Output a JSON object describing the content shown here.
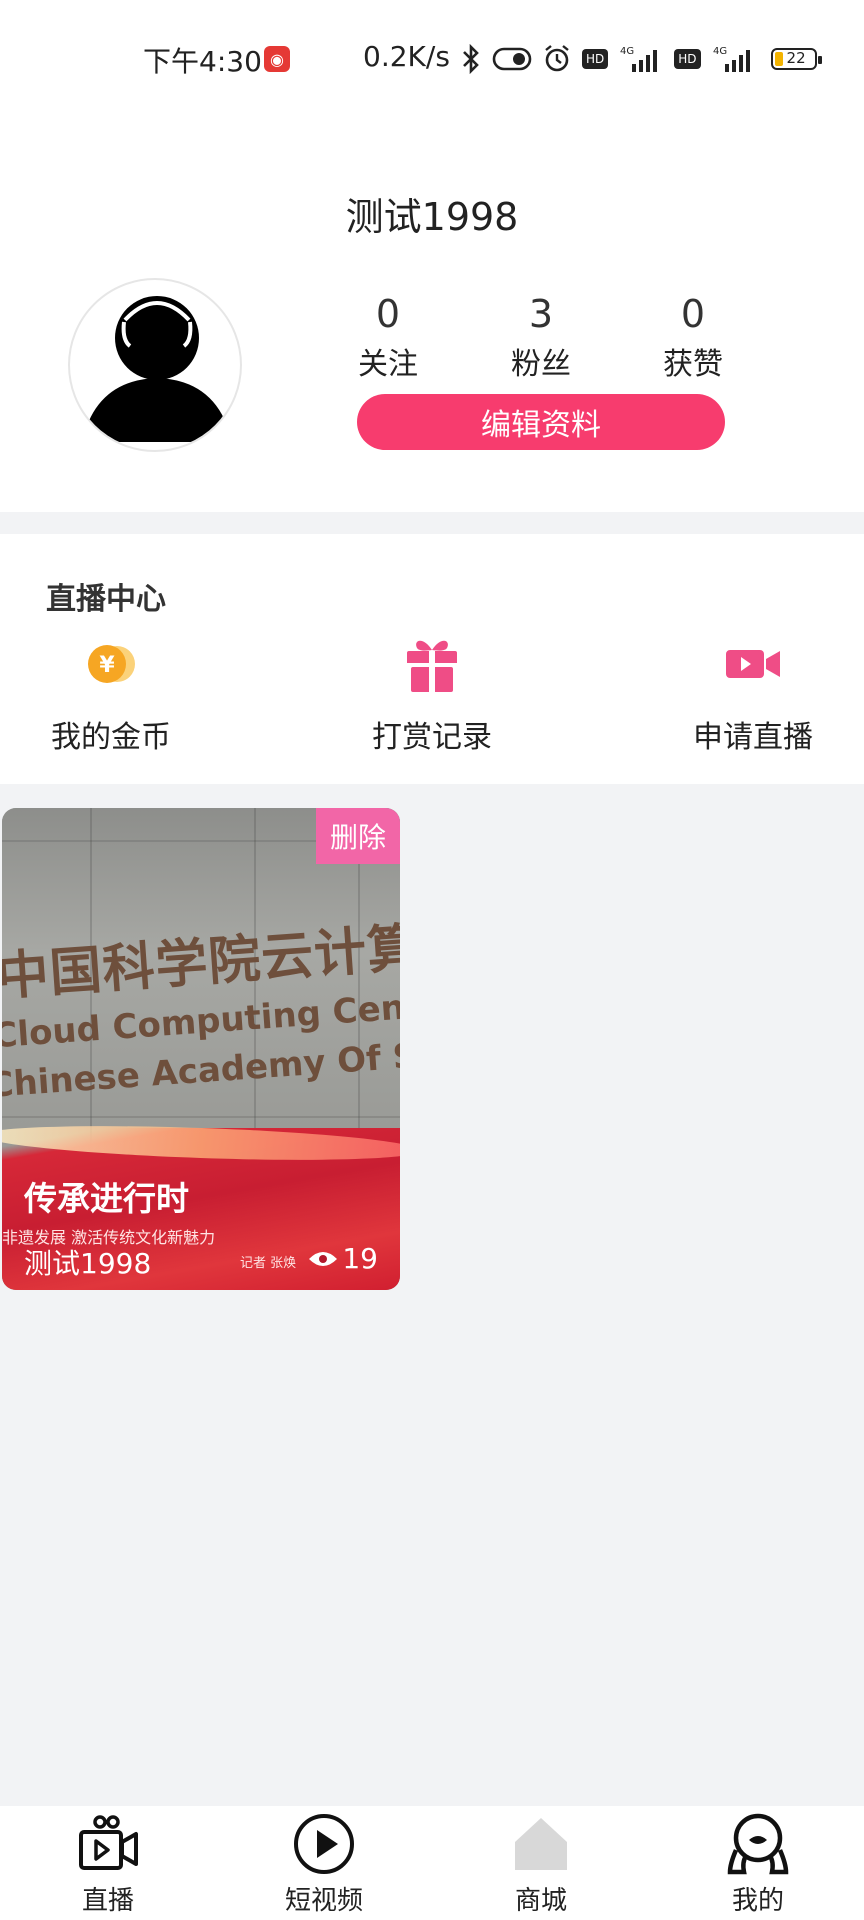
{
  "status_bar": {
    "time": "下午4:30",
    "net_speed": "0.2K/s",
    "hd_label": "HD",
    "network_type": "4G",
    "battery": "22"
  },
  "profile": {
    "name": "测试1998",
    "stats": [
      {
        "value": "0",
        "label": "关注"
      },
      {
        "value": "3",
        "label": "粉丝"
      },
      {
        "value": "0",
        "label": "获赞"
      }
    ],
    "edit_button": "编辑资料"
  },
  "live_center": {
    "title": "直播中心",
    "items": [
      {
        "label": "我的金币",
        "icon": "gold-coin-icon"
      },
      {
        "label": "打赏记录",
        "icon": "gift-icon"
      },
      {
        "label": "申请直播",
        "icon": "video-camera-icon"
      }
    ]
  },
  "videos": [
    {
      "delete_label": "删除",
      "banner_title": "传承进行时",
      "banner_sub": "非遗发展  激活传统文化新魅力",
      "reporter": "记者  张焕",
      "sign_cn": "中国科学院云计算中",
      "sign_en1": "Cloud Computing Center",
      "sign_en2": "Chinese Academy Of Sciences",
      "author": "测试1998",
      "views": "19"
    }
  ],
  "tabbar": {
    "items": [
      {
        "label": "直播",
        "icon": "live-camera-icon"
      },
      {
        "label": "短视频",
        "icon": "play-circle-icon"
      },
      {
        "label": "商城",
        "icon": "home-shop-icon"
      },
      {
        "label": "我的",
        "icon": "profile-icon"
      }
    ]
  },
  "colors": {
    "accent": "#f73c6e",
    "delete_badge": "#f266a7",
    "coin": "#f6a623",
    "gift": "#ef4d86"
  }
}
